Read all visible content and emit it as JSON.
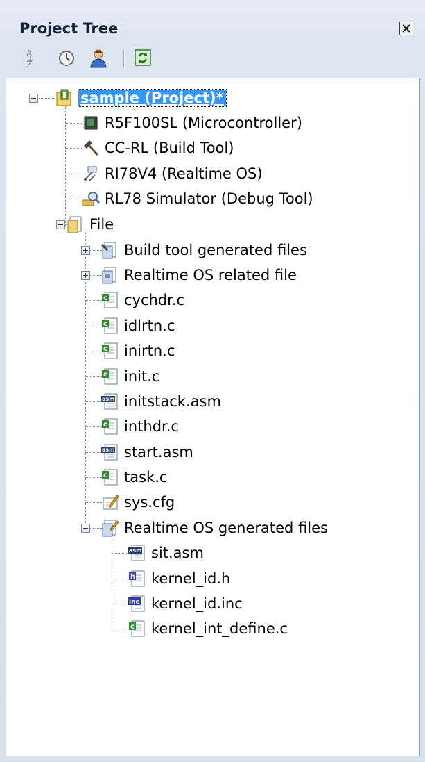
{
  "panel": {
    "title": "Project Tree"
  },
  "toolbar": {
    "buttons": [
      "sort-az-icon",
      "clock-icon",
      "user-icon",
      "refresh-icon"
    ]
  },
  "tree": {
    "root": "sample (Project)*",
    "children": [
      "R5F100SL (Microcontroller)",
      "CC-RL (Build Tool)",
      "RI78V4 (Realtime OS)",
      "RL78 Simulator (Debug Tool)"
    ],
    "file_folder": "File",
    "file_children": [
      "Build tool generated files",
      "Realtime OS related file",
      "cychdr.c",
      "idlrtn.c",
      "inirtn.c",
      "init.c",
      "initstack.asm",
      "inthdr.c",
      "start.asm",
      "task.c",
      "sys.cfg",
      "Realtime OS generated files"
    ],
    "os_generated_children": [
      "sit.asm",
      "kernel_id.h",
      "kernel_id.inc",
      "kernel_int_define.c"
    ]
  }
}
